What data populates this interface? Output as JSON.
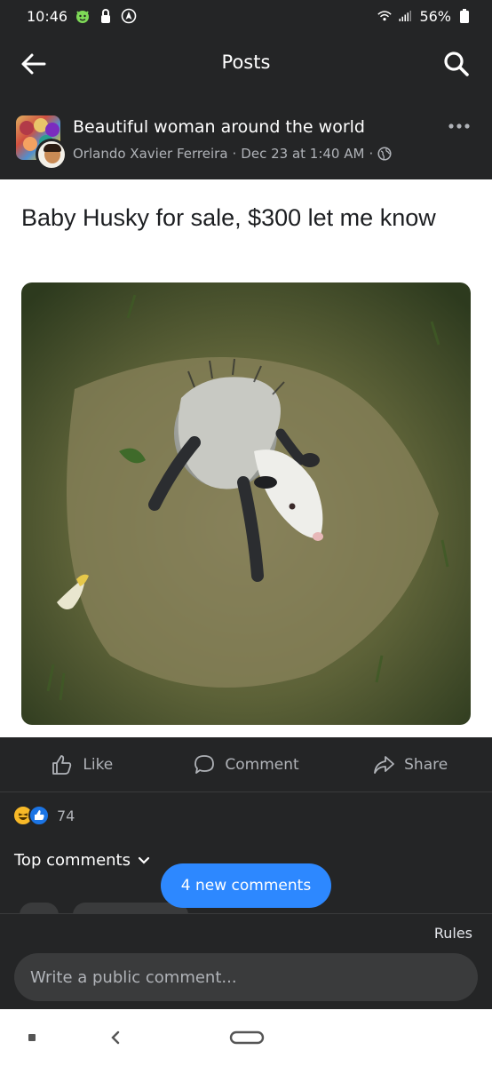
{
  "status_bar": {
    "time": "10:46",
    "battery": "56%",
    "icons": [
      "emoji-devil-icon",
      "lock-icon",
      "navigation-icon",
      "wifi-icon",
      "signal-icon",
      "battery-icon"
    ]
  },
  "header": {
    "title": "Posts",
    "back_icon": "arrow-left-icon",
    "search_icon": "search-icon"
  },
  "post": {
    "group_name": "Beautiful woman around the world",
    "author": "Orlando Xavier Ferreira",
    "timestamp": "Dec 23 at 1:40 AM",
    "separator": "·",
    "privacy_icon": "globe-icon",
    "more_icon": "more-dots-icon",
    "text": "Baby Husky for sale, $300 let me know"
  },
  "actions": {
    "like_label": "Like",
    "comment_label": "Comment",
    "share_label": "Share"
  },
  "reactions": {
    "types": [
      "haha",
      "like"
    ],
    "count": "74"
  },
  "comments": {
    "sort_label": "Top comments",
    "new_comments_label": "4 new comments"
  },
  "composer": {
    "rules_label": "Rules",
    "placeholder": "Write a public comment..."
  },
  "colors": {
    "background": "#242526",
    "accent": "#2d88ff",
    "text_secondary": "#b0b3b8"
  }
}
